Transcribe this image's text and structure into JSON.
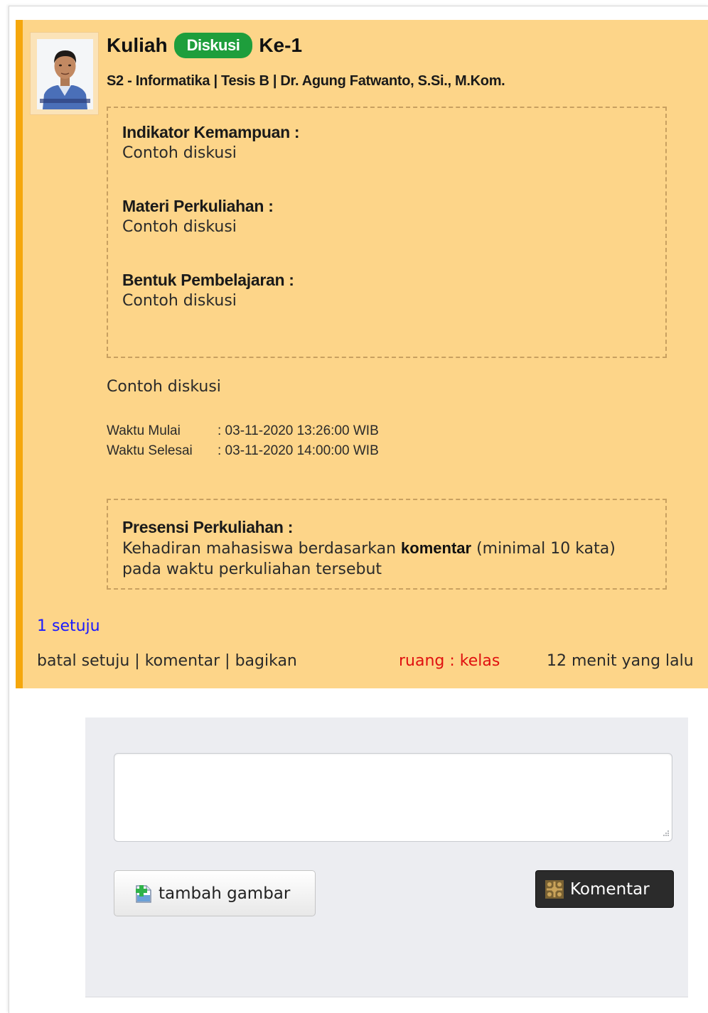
{
  "post": {
    "title_prefix": "Kuliah",
    "badge": "Diskusi",
    "title_suffix": "Ke-1",
    "subtitle": "S2 - Informatika | Tesis B | Dr. Agung Fatwanto, S.Si., M.Kom.",
    "sections": [
      {
        "heading": "Indikator Kemampuan :",
        "text": "Contoh diskusi"
      },
      {
        "heading": "Materi Perkuliahan :",
        "text": "Contoh diskusi"
      },
      {
        "heading": "Bentuk Pembelajaran :",
        "text": "Contoh diskusi"
      }
    ],
    "description": "Contoh diskusi",
    "times": {
      "start_label": "Waktu Mulai",
      "start_value": ": 03-11-2020 13:26:00 WIB",
      "end_label": "Waktu Selesai",
      "end_value": ": 03-11-2020 14:00:00 WIB"
    },
    "presensi": {
      "heading": "Presensi Perkuliahan :",
      "text_before": "Kehadiran mahasiswa berdasarkan ",
      "text_bold": "komentar",
      "text_after": " (minimal 10 kata)",
      "text_line2": "pada waktu perkuliahan tersebut"
    },
    "likes": "1 setuju",
    "actions": {
      "unlike": "batal setuju",
      "comment": "komentar",
      "share": "bagikan",
      "separator": " | "
    },
    "room": "ruang : kelas",
    "timestamp": "12 menit yang lalu"
  },
  "comment_form": {
    "textarea_value": "",
    "add_image_label": "tambah gambar",
    "submit_label": "Komentar"
  },
  "colors": {
    "post_bg": "#fdd589",
    "post_accent": "#f5a70c",
    "badge": "#1e9e3c",
    "link_blue": "#1a1aff",
    "room_red": "#e01010",
    "submit_bg": "#2b2b2b"
  },
  "icons": {
    "add_image": "add-image-icon",
    "submit": "comment-icon"
  }
}
